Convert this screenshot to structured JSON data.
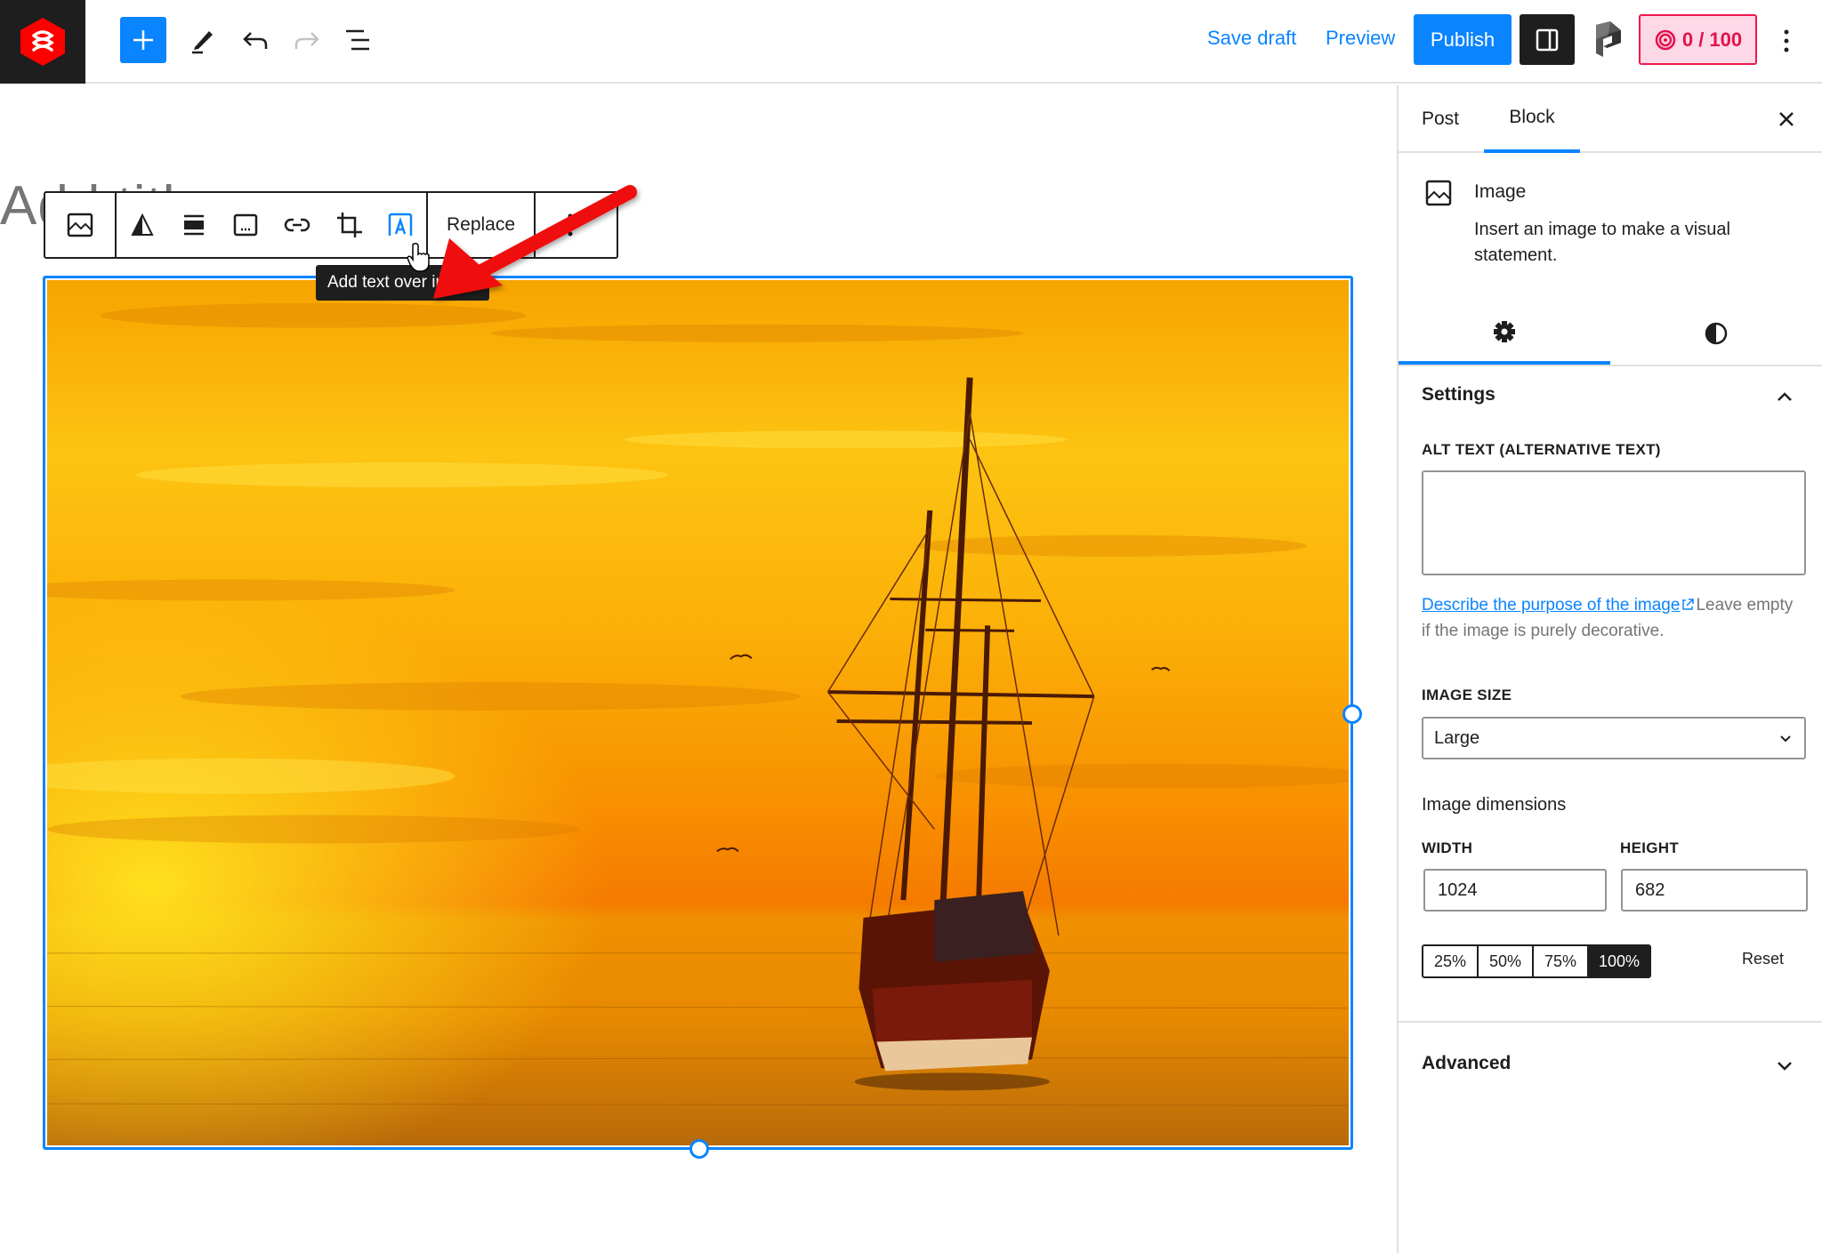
{
  "header": {
    "logo_icon": "brand-hexagon-logo",
    "inserter_icon": "plus-icon",
    "tools_icon": "pencil-icon",
    "undo_icon": "undo-icon",
    "redo_icon": "redo-icon",
    "list_view_icon": "list-view-icon",
    "save_draft_label": "Save draft",
    "preview_label": "Preview",
    "publish_label": "Publish",
    "sidebar_toggle_icon": "sidebar-panel-icon",
    "plugin_icon": "p-logo-icon",
    "score": "0 / 100",
    "score_icon": "fingerprint-icon",
    "more_icon": "vertical-ellipsis-icon",
    "colors": {
      "accent": "#0a84ff",
      "dark": "#1e1e1e",
      "score_bg": "#fdd8e6",
      "score_fg": "#e3124a"
    }
  },
  "editor": {
    "title_placeholder": "Add title",
    "block_toolbar": {
      "items": [
        {
          "name": "image-block-type",
          "icon": "image-icon"
        },
        {
          "name": "duotone",
          "icon": "duotone-triangle-icon"
        },
        {
          "name": "align",
          "icon": "align-wide-icon"
        },
        {
          "name": "caption",
          "icon": "caption-icon"
        },
        {
          "name": "link",
          "icon": "link-icon"
        },
        {
          "name": "crop",
          "icon": "crop-icon"
        },
        {
          "name": "text-over-image",
          "icon": "text-over-image-icon"
        }
      ],
      "replace_label": "Replace",
      "more_icon": "vertical-ellipsis-icon"
    },
    "tooltip": "Add text over image",
    "annotation": "red-arrow-pointing-to-text-over-image-button",
    "image": {
      "description": "Tall ship sailing at sunset over orange sea",
      "selected": true
    }
  },
  "sidebar": {
    "tabs": [
      {
        "label": "Post",
        "active": false
      },
      {
        "label": "Block",
        "active": true
      }
    ],
    "close_icon": "close-icon",
    "block_card": {
      "icon": "image-icon",
      "title": "Image",
      "description": "Insert an image to make a visual statement."
    },
    "subtabs": [
      {
        "icon": "gear-icon",
        "active": true
      },
      {
        "icon": "contrast-icon",
        "active": false
      }
    ],
    "settings": {
      "heading": "Settings",
      "alt_text_label": "ALT TEXT (ALTERNATIVE TEXT)",
      "alt_text_value": "",
      "alt_help_link": "Describe the purpose of the image",
      "alt_help_text": "Leave empty if the image is purely decorative.",
      "image_size_label": "IMAGE SIZE",
      "image_size_value": "Large",
      "dimensions_label": "Image dimensions",
      "width_label": "WIDTH",
      "height_label": "HEIGHT",
      "width_value": "1024",
      "height_value": "682",
      "percent_options": [
        "25%",
        "50%",
        "75%",
        "100%"
      ],
      "percent_selected": "100%",
      "reset_label": "Reset"
    },
    "advanced": {
      "heading": "Advanced"
    }
  }
}
